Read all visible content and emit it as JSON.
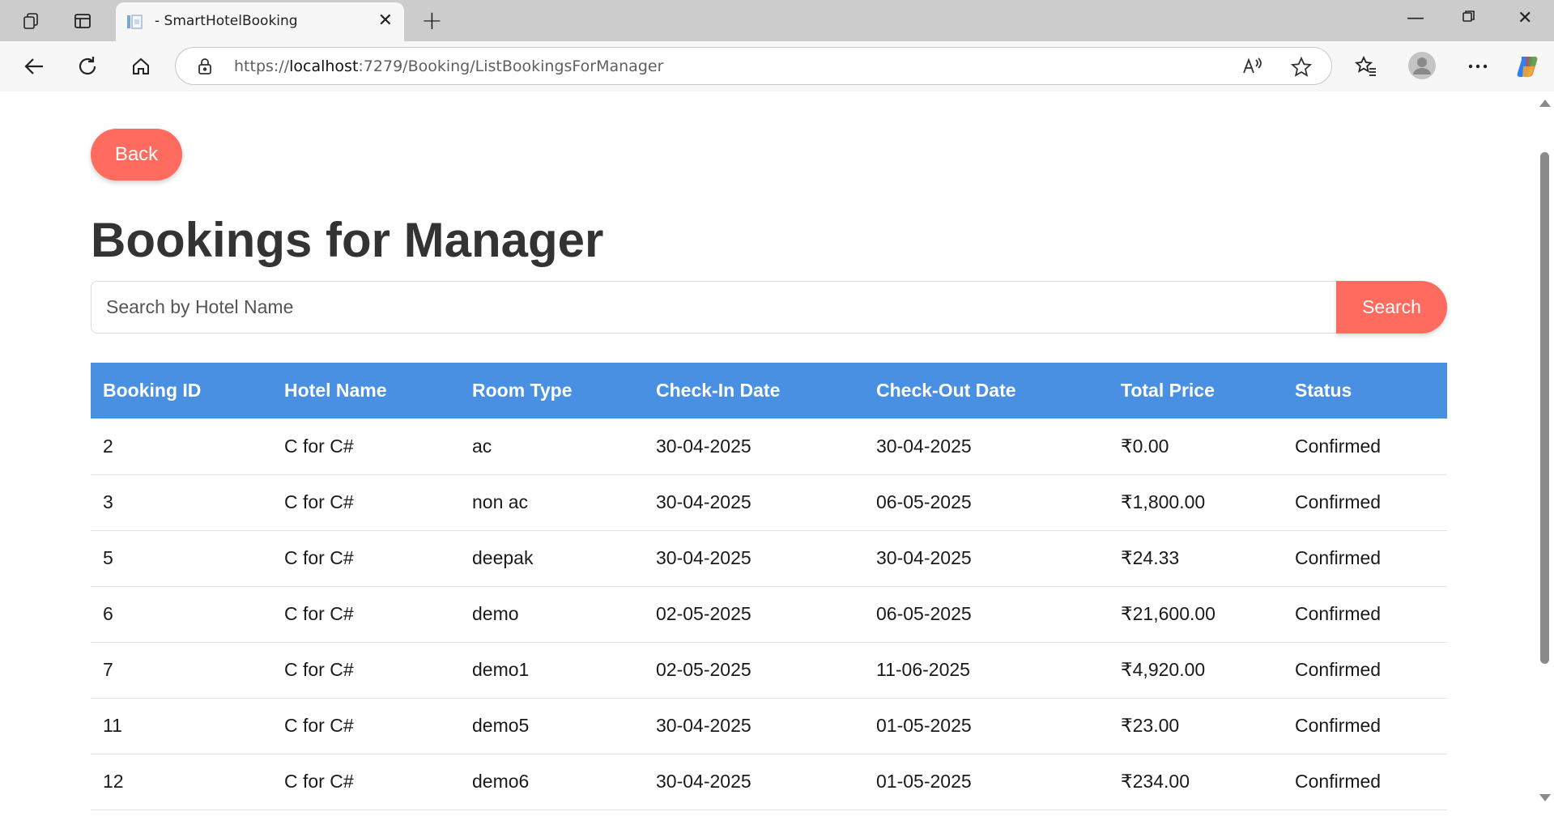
{
  "browser": {
    "tab_title": "- SmartHotelBooking",
    "url_prefix": "https://",
    "url_host": "localhost",
    "url_rest": ":7279/Booking/ListBookingsForManager"
  },
  "page": {
    "back_label": "Back",
    "title": "Bookings for Manager",
    "search": {
      "placeholder": "Search by Hotel Name",
      "value": "",
      "button_label": "Search"
    }
  },
  "table": {
    "headers": [
      "Booking ID",
      "Hotel Name",
      "Room Type",
      "Check-In Date",
      "Check-Out Date",
      "Total Price",
      "Status"
    ],
    "rows": [
      [
        "2",
        "C for C#",
        "ac",
        "30-04-2025",
        "30-04-2025",
        "₹0.00",
        "Confirmed"
      ],
      [
        "3",
        "C for C#",
        "non ac",
        "30-04-2025",
        "06-05-2025",
        "₹1,800.00",
        "Confirmed"
      ],
      [
        "5",
        "C for C#",
        "deepak",
        "30-04-2025",
        "30-04-2025",
        "₹24.33",
        "Confirmed"
      ],
      [
        "6",
        "C for C#",
        "demo",
        "02-05-2025",
        "06-05-2025",
        "₹21,600.00",
        "Confirmed"
      ],
      [
        "7",
        "C for C#",
        "demo1",
        "02-05-2025",
        "11-06-2025",
        "₹4,920.00",
        "Confirmed"
      ],
      [
        "11",
        "C for C#",
        "demo5",
        "30-04-2025",
        "01-05-2025",
        "₹23.00",
        "Confirmed"
      ],
      [
        "12",
        "C for C#",
        "demo6",
        "30-04-2025",
        "01-05-2025",
        "₹234.00",
        "Confirmed"
      ]
    ]
  },
  "colors": {
    "accent_button": "#ff6b5e",
    "table_header": "#4a90e2",
    "title_text": "#333333"
  },
  "icons": [
    "workspaces-icon",
    "tab-actions-icon",
    "page-favicon",
    "close-tab-icon",
    "new-tab-icon",
    "minimize-icon",
    "restore-icon",
    "close-window-icon",
    "back-arrow-icon",
    "refresh-icon",
    "home-icon",
    "lock-icon",
    "read-aloud-icon",
    "favorite-star-icon",
    "favorites-icon",
    "profile-avatar",
    "more-icon",
    "copilot-icon"
  ]
}
